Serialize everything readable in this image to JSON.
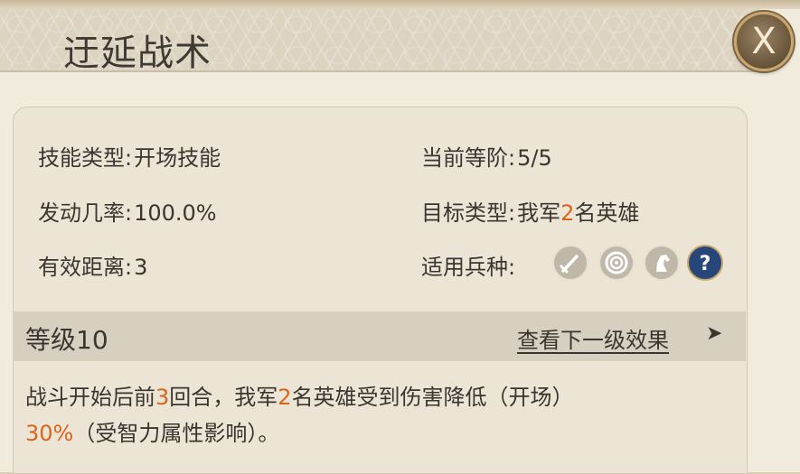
{
  "dialog": {
    "title": "迂延战术",
    "close_label": "X"
  },
  "info": {
    "skill_type": {
      "label": "技能类型:",
      "value": "开场技能"
    },
    "trigger_rate": {
      "label": "发动几率:",
      "value": "100.0%"
    },
    "range": {
      "label": "有效距离:",
      "value": "3"
    },
    "current_level": {
      "label": "当前等阶:",
      "value": "5/5"
    },
    "target_type": {
      "label": "目标类型:",
      "value_prefix": "我军",
      "value_count": "2",
      "value_suffix": "名英雄"
    },
    "troop_types": {
      "label": "适用兵种:",
      "icons": [
        "sword-icon",
        "bow-target-icon",
        "horse-icon",
        "question-mark-icon"
      ]
    }
  },
  "level": {
    "label": "等级10",
    "next_link": "查看下一级效果",
    "arrow": "➤"
  },
  "description": {
    "part1": "战斗开始后前",
    "rounds": "3",
    "part2": "回合，我军",
    "heroes": "2",
    "part3": "名英雄受到伤害降低（开场）",
    "percent": "30%",
    "part4": "（受智力属性影响）。"
  },
  "colors": {
    "highlight": "#d9641c",
    "text": "#3a3530",
    "panel": "#ece5d6",
    "level_bar": "#d7cfbf"
  }
}
